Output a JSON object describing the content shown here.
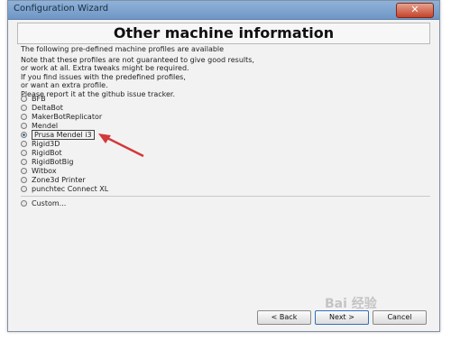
{
  "window": {
    "title": "Configuration Wizard",
    "close_label": "✕"
  },
  "page": {
    "heading": "Other machine information",
    "lines": [
      "The following pre-defined machine profiles are available",
      "Note that these profiles are not guaranteed to give good results,",
      "or work at all. Extra tweaks might be required.",
      "If you find issues with the predefined profiles,",
      "or want an extra profile.",
      "Please report it at the github issue tracker."
    ]
  },
  "options": [
    {
      "label": "BFB",
      "selected": false
    },
    {
      "label": "DeltaBot",
      "selected": false
    },
    {
      "label": "MakerBotReplicator",
      "selected": false
    },
    {
      "label": "Mendel",
      "selected": false
    },
    {
      "label": "Prusa Mendel i3",
      "selected": true
    },
    {
      "label": "Rigid3D",
      "selected": false
    },
    {
      "label": "RigidBot",
      "selected": false
    },
    {
      "label": "RigidBotBig",
      "selected": false
    },
    {
      "label": "Witbox",
      "selected": false
    },
    {
      "label": "Zone3d Printer",
      "selected": false
    },
    {
      "label": "punchtec Connect XL",
      "selected": false
    }
  ],
  "custom_option": {
    "label": "Custom...",
    "selected": false
  },
  "buttons": {
    "back": "< Back",
    "next": "Next >",
    "cancel": "Cancel"
  },
  "watermark": "Bai 经验"
}
